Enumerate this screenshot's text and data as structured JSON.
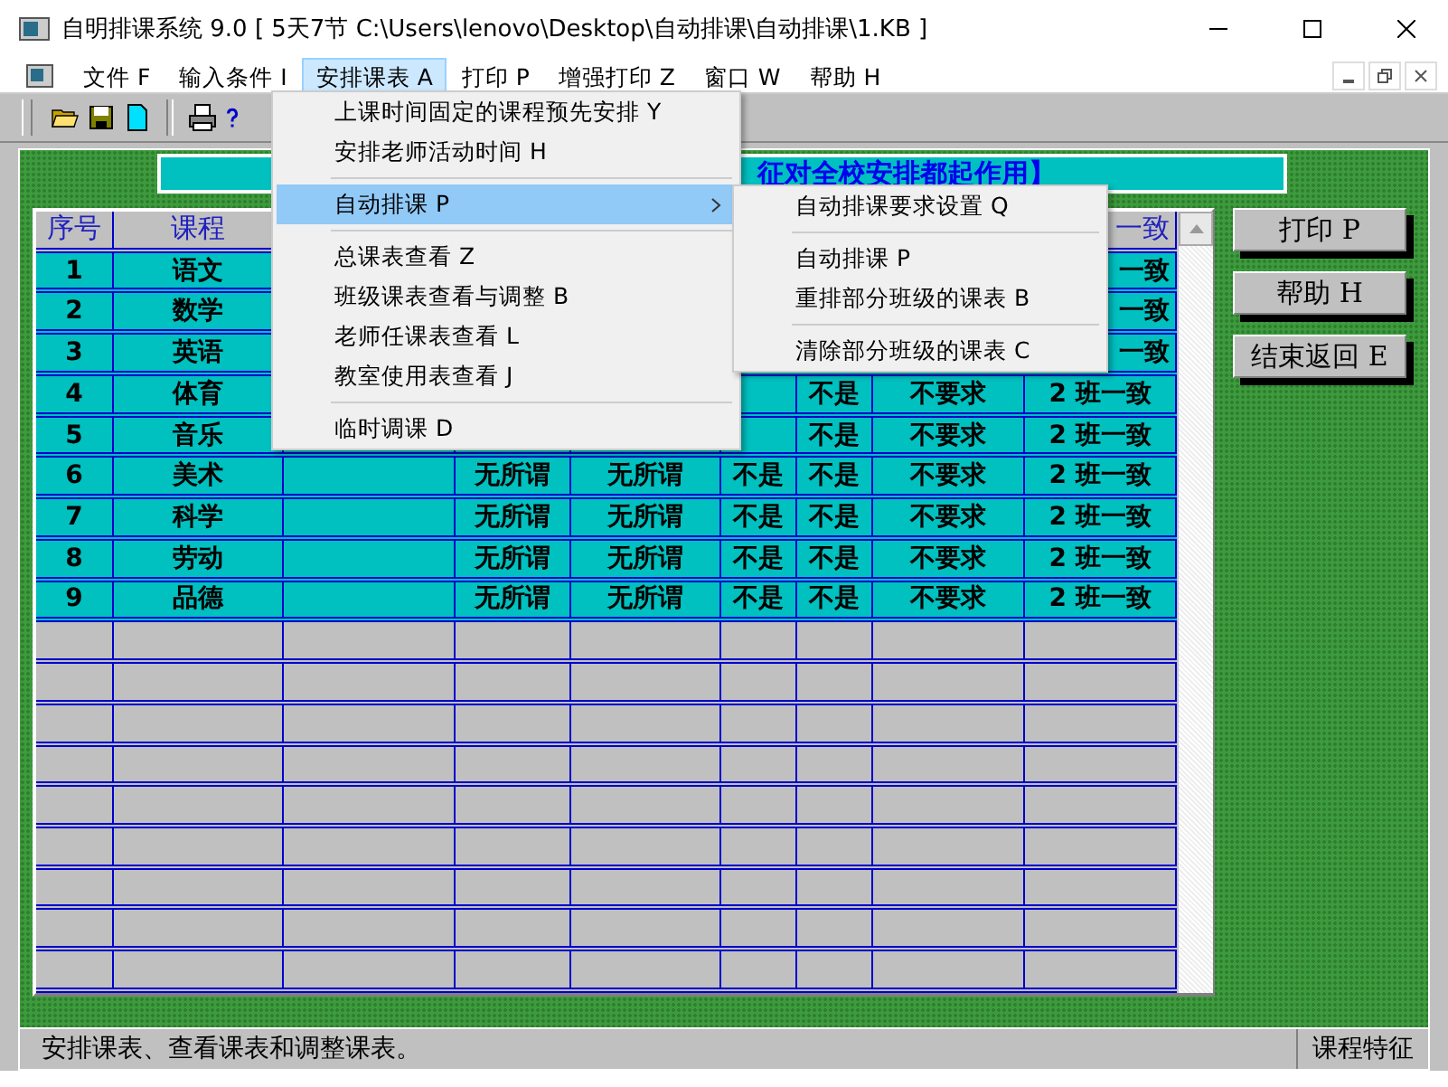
{
  "window": {
    "title": "自明排课系统 9.0 [ 5天7节 C:\\Users\\lenovo\\Desktop\\自动排课\\自动排课\\1.KB ]"
  },
  "menu_bar": [
    {
      "label": "文件 F",
      "selected": false
    },
    {
      "label": "输入条件 I",
      "selected": false
    },
    {
      "label": "安排课表 A",
      "selected": true
    },
    {
      "label": "打印 P",
      "selected": false
    },
    {
      "label": "增强打印 Z",
      "selected": false
    },
    {
      "label": "窗口 W",
      "selected": false
    },
    {
      "label": "帮助 H",
      "selected": false
    }
  ],
  "dropdown": [
    {
      "kind": "item",
      "label": "上课时间固定的课程预先安排 Y",
      "selected": false
    },
    {
      "kind": "item",
      "label": "安排老师活动时间 H",
      "selected": false
    },
    {
      "kind": "separator"
    },
    {
      "kind": "submenu",
      "label": "自动排课 P",
      "selected": true
    },
    {
      "kind": "separator"
    },
    {
      "kind": "item",
      "label": "总课表查看 Z",
      "selected": false
    },
    {
      "kind": "item",
      "label": "班级课表查看与调整 B",
      "selected": false
    },
    {
      "kind": "item",
      "label": "老师任课表查看 L",
      "selected": false
    },
    {
      "kind": "item",
      "label": "教室使用表查看 J",
      "selected": false
    },
    {
      "kind": "separator"
    },
    {
      "kind": "item",
      "label": "临时调课 D",
      "selected": false
    }
  ],
  "submenu": [
    {
      "kind": "item",
      "label": "自动排课要求设置 Q",
      "selected": false
    },
    {
      "kind": "separator"
    },
    {
      "kind": "item",
      "label": "自动排课 P",
      "selected": false
    },
    {
      "kind": "item",
      "label": "重排部分班级的课表 B",
      "selected": false
    },
    {
      "kind": "separator"
    },
    {
      "kind": "item",
      "label": "清除部分班级的课表 C",
      "selected": false
    }
  ],
  "banner": "征对全校安排都起作用】",
  "table": {
    "header": {
      "cells": [
        "序号",
        "课程"
      ],
      "right_cells": [
        "一致"
      ]
    },
    "rows": [
      {
        "cells": [
          "1",
          "语文"
        ],
        "right_cells": [
          "一致"
        ]
      },
      {
        "cells": [
          "2",
          "数学"
        ],
        "right_cells": [
          "一致"
        ]
      },
      {
        "cells": [
          "3",
          "英语"
        ],
        "right_cells": [
          "一致"
        ]
      },
      {
        "cells": [
          "4",
          "体育"
        ],
        "right_cells": [
          "不是",
          "不要求",
          "2 班一致"
        ]
      },
      {
        "cells": [
          "5",
          "音乐"
        ],
        "right_cells": [
          "不是",
          "不要求",
          "2 班一致"
        ]
      },
      {
        "cells": [
          "6",
          "美术",
          "",
          "无所谓",
          "无所谓",
          "不是",
          "不是",
          "不要求",
          "2 班一致"
        ]
      },
      {
        "cells": [
          "7",
          "科学",
          "",
          "无所谓",
          "无所谓",
          "不是",
          "不是",
          "不要求",
          "2 班一致"
        ]
      },
      {
        "cells": [
          "8",
          "劳动",
          "",
          "无所谓",
          "无所谓",
          "不是",
          "不是",
          "不要求",
          "2 班一致"
        ]
      },
      {
        "cells": [
          "9",
          "品德",
          "",
          "无所谓",
          "无所谓",
          "不是",
          "不是",
          "不要求",
          "2 班一致"
        ]
      }
    ]
  },
  "buttons": [
    "打印 P",
    "帮助 H",
    "结束返回 E"
  ],
  "status_bar": {
    "message": "安排课表、查看课表和调整课表。",
    "panel": "课程特征"
  }
}
